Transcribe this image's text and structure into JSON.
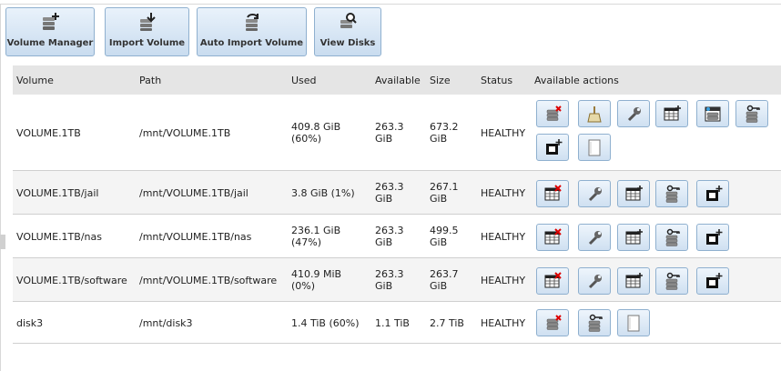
{
  "toolbar": {
    "buttons": [
      {
        "label": "Volume Manager",
        "icon": "disk-add-icon"
      },
      {
        "label": "Import Volume",
        "icon": "disk-import-icon"
      },
      {
        "label": "Auto Import Volume",
        "icon": "disk-auto-import-icon"
      },
      {
        "label": "View Disks",
        "icon": "disk-view-icon"
      }
    ]
  },
  "table": {
    "headers": [
      "Volume",
      "Path",
      "Used",
      "Available",
      "Size",
      "Status",
      "Available actions"
    ],
    "rows": [
      {
        "volume": "VOLUME.1TB",
        "path": "/mnt/VOLUME.1TB",
        "used": [
          "409.8 GiB",
          "(60%)"
        ],
        "available": [
          "263.3",
          "GiB"
        ],
        "size": [
          "673.2",
          "GiB"
        ],
        "status": "HEALTHY",
        "actions": [
          "detach-volume-icon",
          "scrub-volume-icon",
          "edit-options-icon",
          "create-dataset-icon",
          "create-zvol-icon",
          "change-permissions-icon",
          "create-snapshot-icon",
          "volume-status-icon"
        ]
      },
      {
        "volume": "VOLUME.1TB/jail",
        "path": "/mnt/VOLUME.1TB/jail",
        "used": [
          "3.8 GiB (1%)"
        ],
        "available": [
          "263.3",
          "GiB"
        ],
        "size": [
          "267.1",
          "GiB"
        ],
        "status": "HEALTHY",
        "actions": [
          "delete-dataset-icon",
          "edit-options-icon",
          "create-dataset-icon",
          "change-permissions-icon",
          "create-snapshot-icon"
        ]
      },
      {
        "volume": "VOLUME.1TB/nas",
        "path": "/mnt/VOLUME.1TB/nas",
        "used": [
          "236.1 GiB",
          "(47%)"
        ],
        "available": [
          "263.3",
          "GiB"
        ],
        "size": [
          "499.5",
          "GiB"
        ],
        "status": "HEALTHY",
        "actions": [
          "delete-dataset-icon",
          "edit-options-icon",
          "create-dataset-icon",
          "change-permissions-icon",
          "create-snapshot-icon"
        ]
      },
      {
        "volume": "VOLUME.1TB/software",
        "path": "/mnt/VOLUME.1TB/software",
        "used": [
          "410.9 MiB",
          "(0%)"
        ],
        "available": [
          "263.3",
          "GiB"
        ],
        "size": [
          "263.7",
          "GiB"
        ],
        "status": "HEALTHY",
        "actions": [
          "delete-dataset-icon",
          "edit-options-icon",
          "create-dataset-icon",
          "change-permissions-icon",
          "create-snapshot-icon"
        ]
      },
      {
        "volume": "disk3",
        "path": "/mnt/disk3",
        "used": [
          "1.4 TiB (60%)"
        ],
        "available": [
          "1.1 TiB"
        ],
        "size": [
          "2.7 TiB"
        ],
        "status": "HEALTHY",
        "actions": [
          "detach-volume-icon",
          "change-permissions-icon",
          "volume-status-icon"
        ]
      }
    ]
  }
}
